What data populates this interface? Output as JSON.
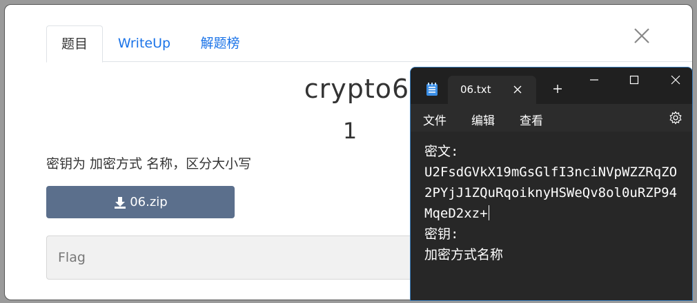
{
  "tabs": [
    {
      "label": "题目"
    },
    {
      "label": "WriteUp"
    },
    {
      "label": "解题榜"
    }
  ],
  "challenge": {
    "title": "crypto6",
    "score": "1",
    "description": "密钥为 加密方式 名称，区分大小写",
    "download_label": "06.zip",
    "flag_placeholder": "Flag"
  },
  "notepad": {
    "tab_title": "06.txt",
    "menu": [
      "文件",
      "编辑",
      "查看"
    ],
    "lines": [
      "密文:",
      "U2FsdGVkX19mGsGlfI3nciNVpWZZRqZO",
      "2PYjJ1ZQuRqoiknyHSWeQv8ol0uRZP94",
      "MqeD2xz+",
      "密钥:",
      "加密方式名称"
    ]
  },
  "colors": {
    "link": "#1a73e8",
    "button": "#5b6f8c",
    "notepad_bg": "#272727"
  }
}
